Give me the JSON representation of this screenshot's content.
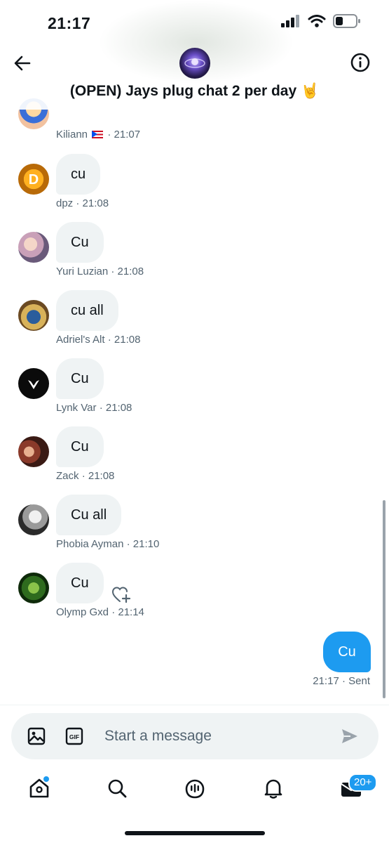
{
  "status": {
    "time": "21:17"
  },
  "header": {
    "title": "(OPEN) Jays plug chat 2 per day 🤘"
  },
  "messages": [
    {
      "text": "",
      "author": "Kiliann",
      "time": "· 21:07",
      "flag": "puerto-rico-flag"
    },
    {
      "text": "cu",
      "author": "dpz",
      "time": "· 21:08"
    },
    {
      "text": "Cu",
      "author": "Yuri Luzian",
      "time": "· 21:08"
    },
    {
      "text": "cu all",
      "author": "Adriel's Alt",
      "time": "· 21:08"
    },
    {
      "text": "Cu",
      "author": "Lynk Var",
      "time": "· 21:08"
    },
    {
      "text": "Cu",
      "author": "Zack",
      "time": "· 21:08"
    },
    {
      "text": "Cu all",
      "author": "Phobia Ayman",
      "time": "· 21:10"
    },
    {
      "text": "Cu",
      "author": "Olymp Gxd",
      "time": "· 21:14"
    }
  ],
  "sent_message": {
    "text": "Cu",
    "time": "21:17",
    "status": "· Sent"
  },
  "composer": {
    "placeholder": "Start a message"
  },
  "tabbar": {
    "messages_badge": "20+"
  },
  "icons": [
    "back-arrow-icon",
    "info-icon",
    "image-icon",
    "gif-icon",
    "send-icon",
    "home-icon",
    "search-icon",
    "spaces-icon",
    "bell-icon",
    "mail-icon",
    "add-reaction-icon"
  ],
  "colors": {
    "accent": "#1d9bf0",
    "bubble": "#eff3f4",
    "meta": "#536471"
  }
}
